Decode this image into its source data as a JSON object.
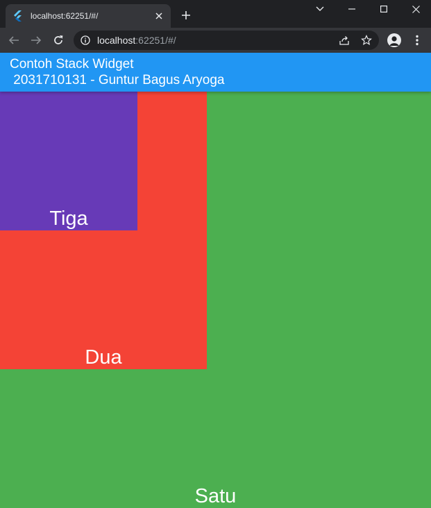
{
  "browser": {
    "tab": {
      "title": "localhost:62251/#/"
    },
    "address": {
      "host": "localhost",
      "rest": ":62251/#/"
    }
  },
  "app": {
    "title_line1": "Contoh Stack Widget",
    "title_line2": " 2031710131 - Guntur Bagus Aryoga"
  },
  "stack": {
    "satu": {
      "label": "Satu",
      "color": "#4caf50"
    },
    "dua": {
      "label": "Dua",
      "color": "#f44336"
    },
    "tiga": {
      "label": "Tiga",
      "color": "#673ab7"
    }
  },
  "colors": {
    "appbar": "#2196f3",
    "chrome_dark": "#202124",
    "chrome_toolbar": "#35363a"
  }
}
